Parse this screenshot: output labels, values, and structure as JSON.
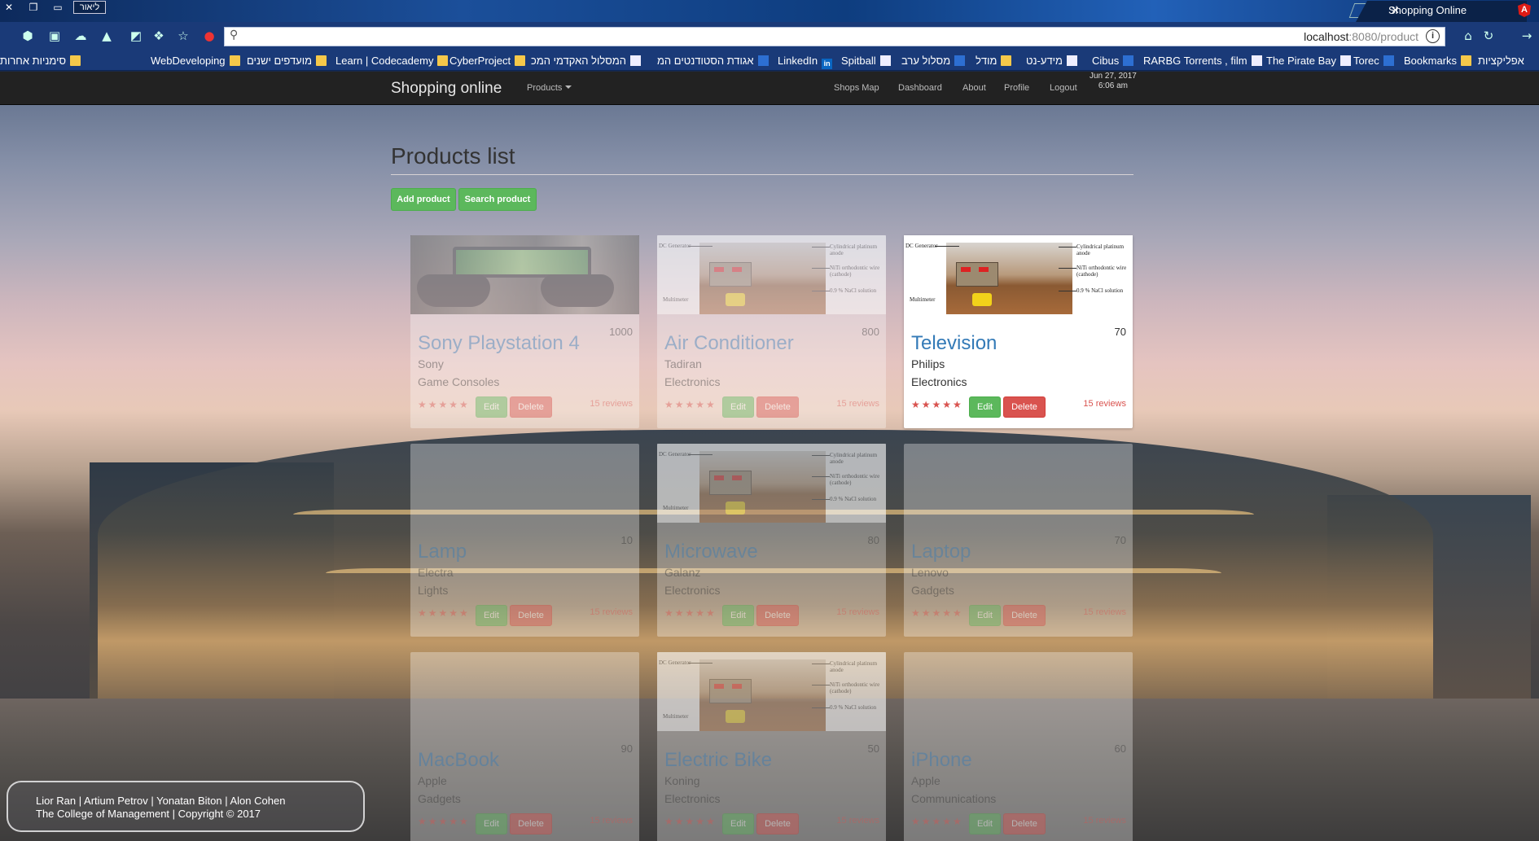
{
  "browser": {
    "profile_label": "ליאור",
    "tab_title": "Shopping Online",
    "url_host": "localhost",
    "url_rest": ":8080/product",
    "bookmarks": [
      {
        "label": "סימניות אחרות",
        "icon": "folder-icon"
      },
      {
        "label": "WebDeveloping",
        "icon": "folder-icon"
      },
      {
        "label": "מועדפים ישנים",
        "icon": "folder-icon"
      },
      {
        "label": "Learn | Codecademy",
        "icon": "folder-icon"
      },
      {
        "label": "CyberProject",
        "icon": "folder-icon"
      },
      {
        "label": "המסלול האקדמי המכ",
        "icon": "college-icon"
      },
      {
        "label": "אגודת הסטודנטים המ",
        "icon": "union-icon"
      },
      {
        "label": "LinkedIn",
        "icon": "linkedin-icon"
      },
      {
        "label": "Spitball",
        "icon": "spitball-icon"
      },
      {
        "label": "מסלול ערב",
        "icon": "evening-icon"
      },
      {
        "label": "מודל",
        "icon": "moodle-icon"
      },
      {
        "label": "מידע-נט",
        "icon": "meida-icon"
      },
      {
        "label": "Cibus",
        "icon": "cibus-icon"
      },
      {
        "label": "RARBG Torrents , film",
        "icon": "rarbg-icon"
      },
      {
        "label": "The Pirate Bay",
        "icon": "piratebay-icon"
      },
      {
        "label": "Torec",
        "icon": "torec-icon"
      },
      {
        "label": "Bookmarks",
        "icon": "star-icon"
      },
      {
        "label": "אפליקציות",
        "icon": "apps-icon"
      }
    ]
  },
  "navbar": {
    "brand": "Shopping online",
    "products_menu": "Products",
    "links": [
      "Shops Map",
      "Dashboard",
      "About",
      "Profile",
      "Logout"
    ],
    "date": "Jun 27, 2017",
    "time": "6:06 am"
  },
  "main": {
    "title": "Products list",
    "add_button": "Add product",
    "search_button": "Search product",
    "edit_label": "Edit",
    "delete_label": "Delete",
    "stars": "★★★★★",
    "products": [
      {
        "name": "Sony Playstation 4",
        "price": "1000",
        "brand": "Sony",
        "category": "Game Consoles",
        "reviews": "15 reviews",
        "image": "ps4"
      },
      {
        "name": "Air Conditioner",
        "price": "800",
        "brand": "Tadiran",
        "category": "Electronics",
        "reviews": "15 reviews",
        "image": "diagram"
      },
      {
        "name": "Television",
        "price": "70",
        "brand": "Philips",
        "category": "Electronics",
        "reviews": "15 reviews",
        "image": "diagram"
      },
      {
        "name": "Lamp",
        "price": "10",
        "brand": "Electra",
        "category": "Lights",
        "reviews": "15 reviews",
        "image": "none"
      },
      {
        "name": "Microwave",
        "price": "80",
        "brand": "Galanz",
        "category": "Electronics",
        "reviews": "15 reviews",
        "image": "diagram"
      },
      {
        "name": "Laptop",
        "price": "70",
        "brand": "Lenovo",
        "category": "Gadgets",
        "reviews": "15 reviews",
        "image": "none"
      },
      {
        "name": "MacBook",
        "price": "90",
        "brand": "Apple",
        "category": "Gadgets",
        "reviews": "15 reviews",
        "image": "none"
      },
      {
        "name": "Electric Bike",
        "price": "50",
        "brand": "Koning",
        "category": "Electronics",
        "reviews": "15 reviews",
        "image": "diagram"
      },
      {
        "name": "iPhone",
        "price": "60",
        "brand": "Apple",
        "category": "Communications",
        "reviews": "15 reviews",
        "image": "none"
      }
    ],
    "diagram_labels": {
      "dc": "DC Generator",
      "cyl": "Cylindrical platinum",
      "anode": "anode",
      "niti": "NiTi orthodontic wire",
      "cathode": "(cathode)",
      "nacl": "0.9 % NaCl solution",
      "multi": "Multimeter"
    }
  },
  "footer": {
    "authors": "Lior Ran | Artium Petrov | Yonatan Biton | Alon Cohen",
    "copyright": "The College of Management | Copyright © 2017"
  },
  "colors": {
    "navbar": "#222222",
    "success": "#5cb85c",
    "danger": "#d9534f",
    "link": "#337ab7"
  }
}
